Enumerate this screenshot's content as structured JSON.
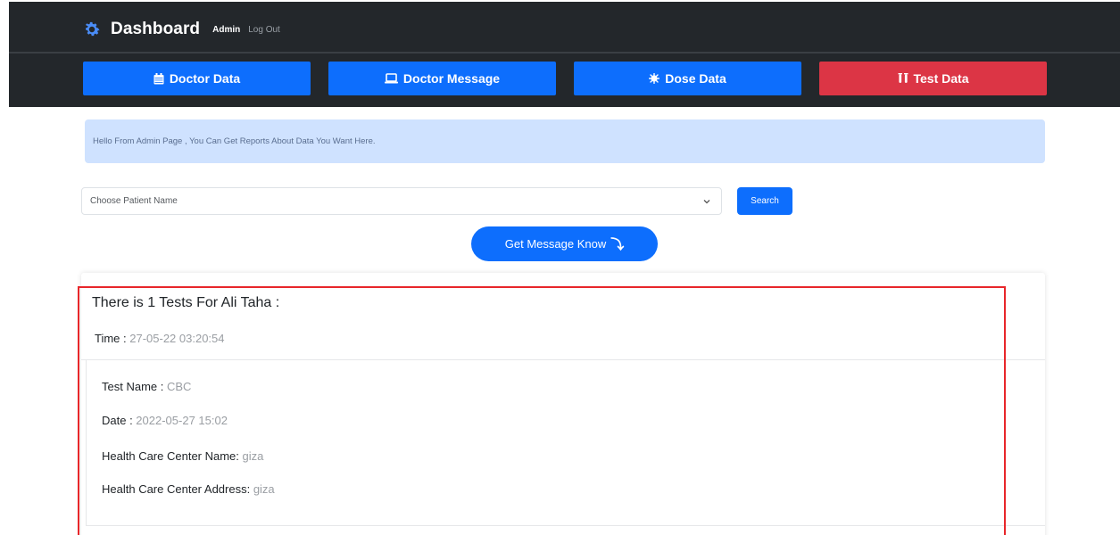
{
  "header": {
    "brand_title": "Dashboard",
    "admin_link": "Admin",
    "logout_link": "Log Out"
  },
  "nav": {
    "doctor_data": "Doctor Data",
    "doctor_message": "Doctor Message",
    "dose_data": "Dose Data",
    "test_data": "Test Data"
  },
  "alert": {
    "text": "Hello From Admin Page , You Can Get Reports About Data You Want Here."
  },
  "form": {
    "select_value": "Choose Patient Name",
    "search_label": "Search"
  },
  "get_message_button": "Get Message Know",
  "result": {
    "title": "There is 1 Tests For Ali Taha :",
    "time_label": "Time : ",
    "time_value": "27-05-22 03:20:54",
    "test_name_label": "Test Name : ",
    "test_name_value": "CBC",
    "date_label": "Date : ",
    "date_value": "2022-05-27 15:02",
    "hcc_name_label": "Health Care Center Name: ",
    "hcc_name_value": "giza",
    "hcc_address_label": "Health Care Center Address: ",
    "hcc_address_value": "giza"
  },
  "colors": {
    "navbar": "#23272b",
    "primary": "#0d6efd",
    "danger": "#dc3545",
    "alert_bg": "#cfe2ff",
    "highlight": "#e8262a"
  }
}
